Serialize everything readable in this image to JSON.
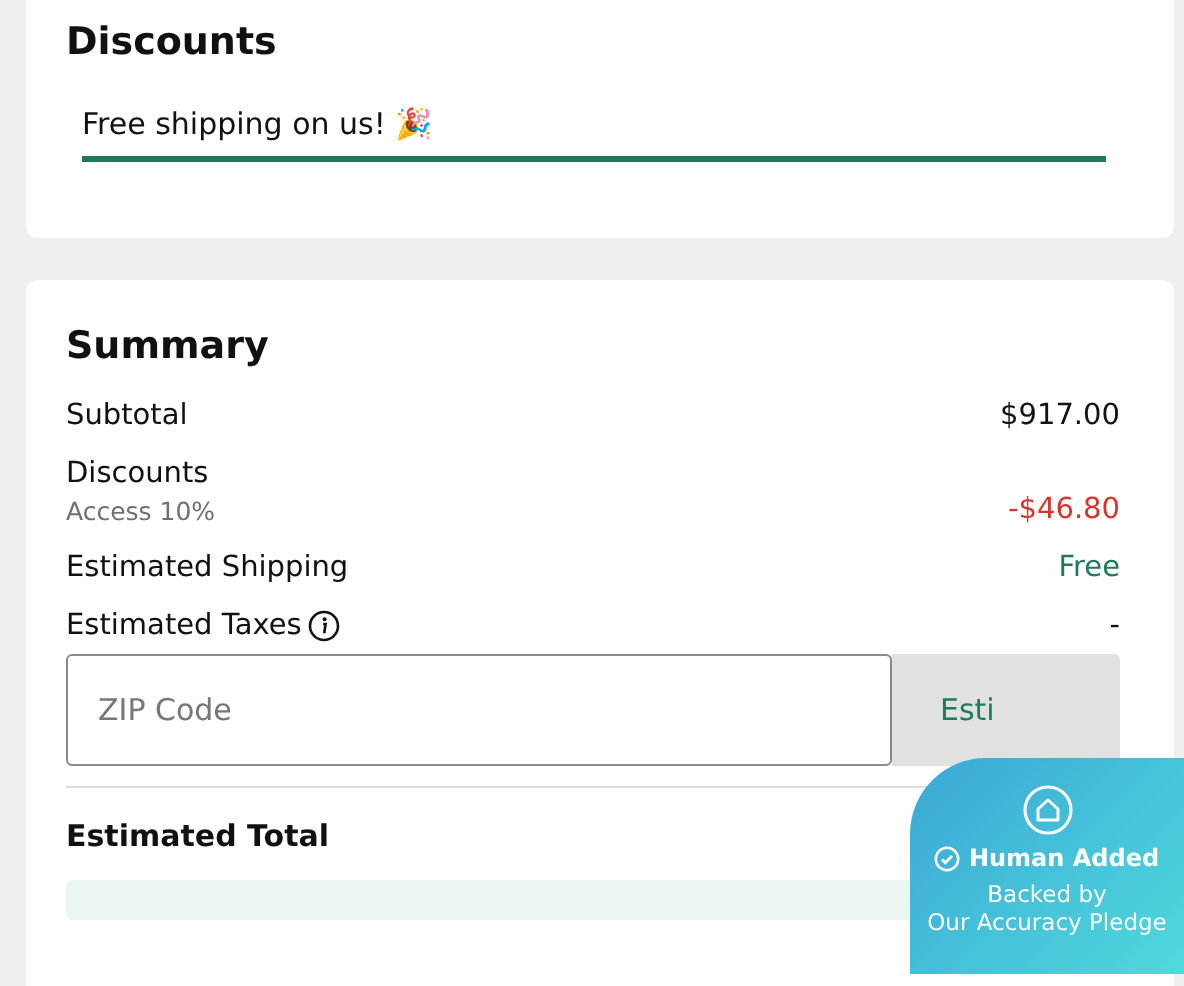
{
  "discounts": {
    "title": "Discounts",
    "promo": "Free shipping on us! 🎉"
  },
  "summary": {
    "title": "Summary",
    "rows": [
      {
        "kind": "plain",
        "label": "Subtotal",
        "value": "$917.00"
      },
      {
        "kind": "discount",
        "label": "Discounts",
        "note": "Access 10%",
        "value": "-$46.80"
      },
      {
        "kind": "free",
        "label": "Estimated Shipping",
        "value": "Free"
      },
      {
        "kind": "info",
        "label": "Estimated Taxes",
        "value": "-"
      }
    ],
    "zip": {
      "placeholder": "ZIP Code",
      "button": "Esti"
    },
    "total": {
      "label": "Estimated Total"
    }
  },
  "badge": {
    "title": "Human Added",
    "line_1": "Backed by",
    "line_2": "Our Accuracy Pledge"
  }
}
